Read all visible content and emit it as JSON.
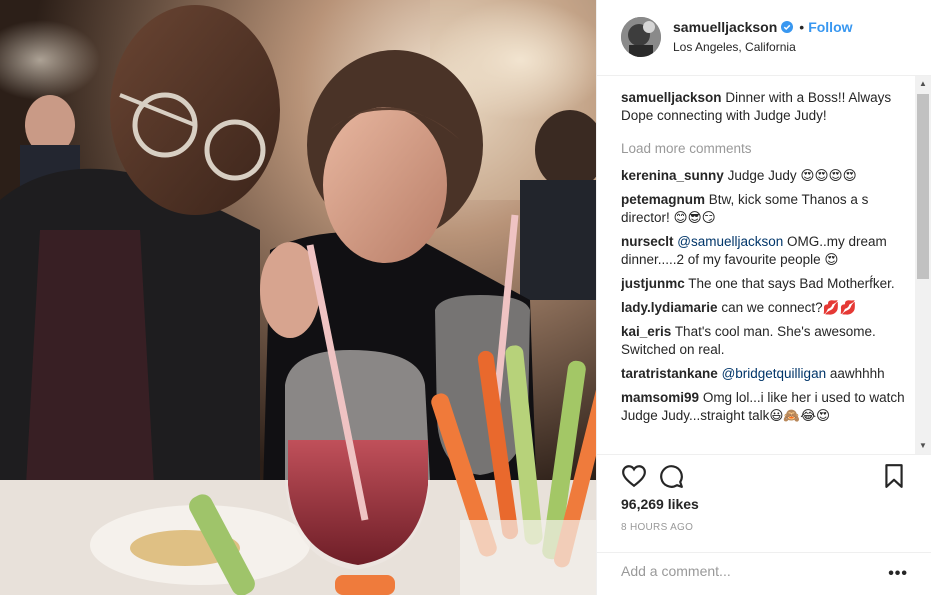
{
  "post": {
    "username": "samuelljackson",
    "follow_label": "Follow",
    "separator": "•",
    "location": "Los Angeles, California"
  },
  "caption": {
    "username": "samuelljackson",
    "text": "Dinner with a Boss!! Always Dope connecting with Judge Judy!"
  },
  "load_more_label": "Load more comments",
  "comments": [
    {
      "user": "kerenina_sunny",
      "pre": "Judge Judy ",
      "mention": "",
      "post": "",
      "emoji": "😍😍😍😍"
    },
    {
      "user": "petemagnum",
      "pre": "Btw, kick some Thanos a  s director! ",
      "mention": "",
      "post": "",
      "emoji": "😊😎😏"
    },
    {
      "user": "nurseclt",
      "pre": "",
      "mention": "@samuelljackson",
      "post": " OMG..my dream dinner.....2 of my favourite people ",
      "emoji": "😍"
    },
    {
      "user": "justjunmc",
      "pre": "The one that says Bad Motherf́ker.",
      "mention": "",
      "post": "",
      "emoji": ""
    },
    {
      "user": "lady.lydiamarie",
      "pre": "can we connect?",
      "mention": "",
      "post": "",
      "emoji": "💋💋"
    },
    {
      "user": "kai_eris",
      "pre": "That's cool man. She's awesome. Switched on real.",
      "mention": "",
      "post": "",
      "emoji": ""
    },
    {
      "user": "taratristankane",
      "pre": "",
      "mention": "@bridgetquilligan",
      "post": " aawhhhh",
      "emoji": ""
    },
    {
      "user": "mamsomi99",
      "pre": "Omg lol...i like her",
      "mention": "",
      "post": " i used to watch Judge Judy...straight talk",
      "emoji": "😃🙈😂😍"
    }
  ],
  "likes": "96,269 likes",
  "time": "8 HOURS AGO",
  "add_comment_placeholder": "Add a comment...",
  "more_options": "•••",
  "colors": {
    "link": "#3897f0",
    "mention": "#003569",
    "muted": "#999999",
    "text": "#262626",
    "border": "#efefef"
  },
  "icons": [
    "heart-icon",
    "comment-icon",
    "bookmark-icon",
    "verified-badge-icon",
    "more-options-icon",
    "scroll-up-icon",
    "scroll-down-icon"
  ]
}
